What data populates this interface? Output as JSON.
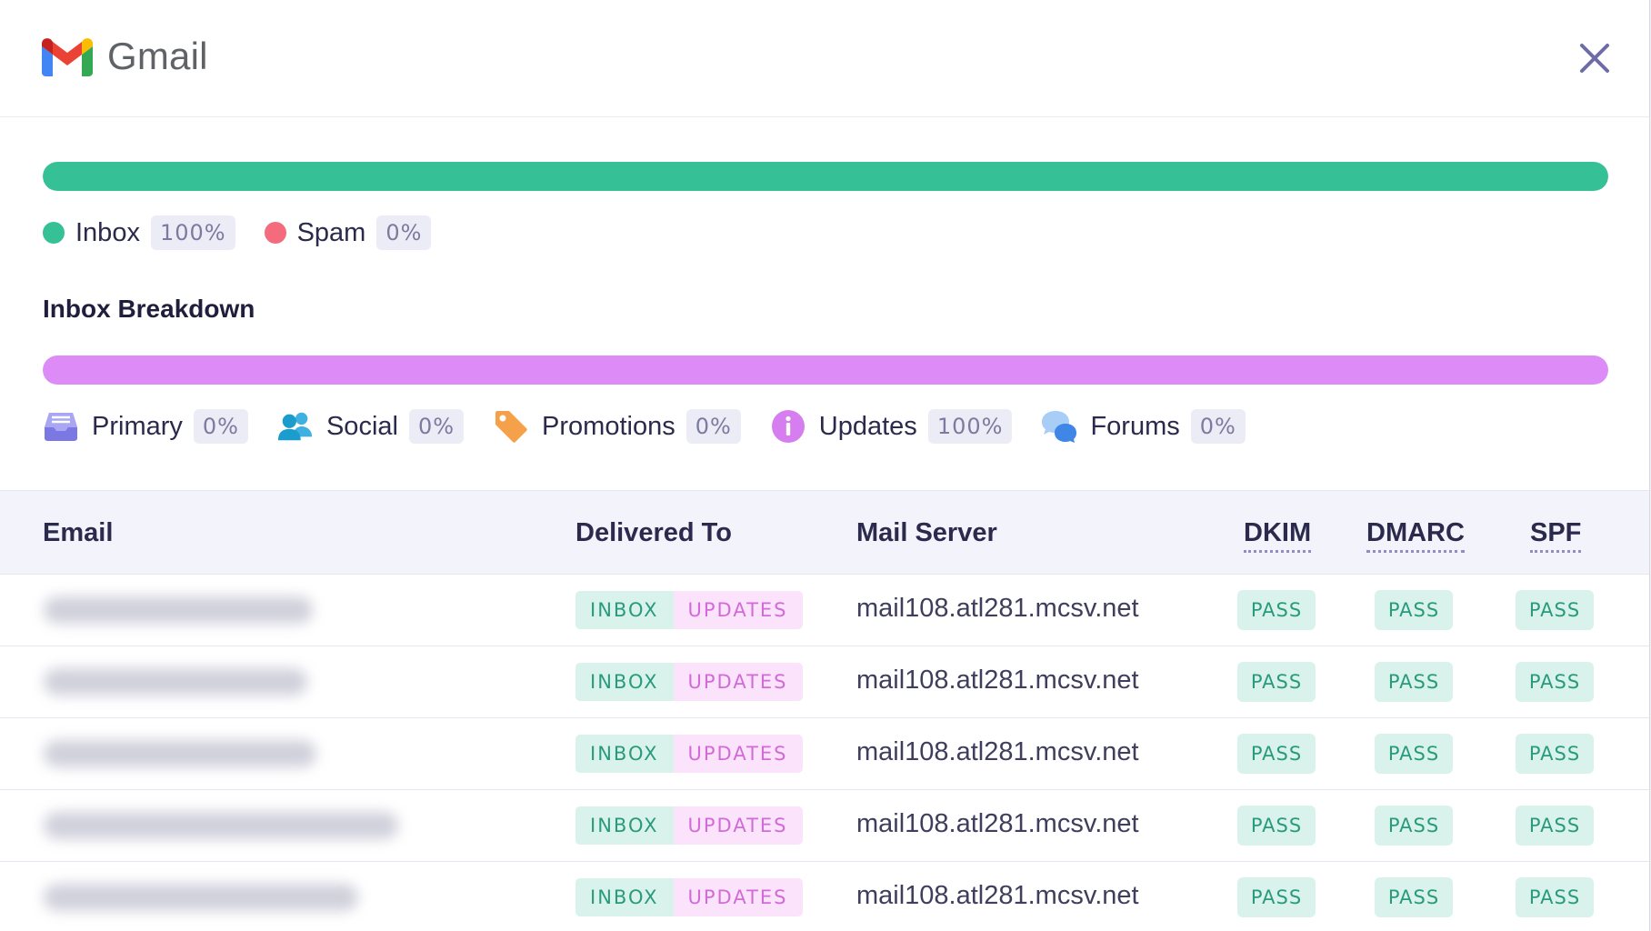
{
  "header": {
    "brand": "Gmail",
    "logo_icon": "gmail-logo-icon",
    "close_icon": "close-icon"
  },
  "placement": {
    "bar_fill_fraction": 1.0,
    "bar_color": "#35c095",
    "items": [
      {
        "label": "Inbox",
        "percent": "100%",
        "color": "#35c095"
      },
      {
        "label": "Spam",
        "percent": "0%",
        "color": "#f46b7d"
      }
    ]
  },
  "breakdown": {
    "title": "Inbox Breakdown",
    "bar_fill_fraction": 1.0,
    "bar_color": "#dd8bf7",
    "items": [
      {
        "label": "Primary",
        "percent": "0%",
        "icon": "inbox-tray-icon"
      },
      {
        "label": "Social",
        "percent": "0%",
        "icon": "people-icon"
      },
      {
        "label": "Promotions",
        "percent": "0%",
        "icon": "tag-icon"
      },
      {
        "label": "Updates",
        "percent": "100%",
        "icon": "info-icon"
      },
      {
        "label": "Forums",
        "percent": "0%",
        "icon": "chat-bubbles-icon"
      }
    ]
  },
  "table": {
    "columns": {
      "email": "Email",
      "delivered_to": "Delivered To",
      "mail_server": "Mail Server",
      "dkim": "DKIM",
      "dmarc": "DMARC",
      "spf": "SPF"
    },
    "rows": [
      {
        "delivered_folder": "INBOX",
        "delivered_tab": "UPDATES",
        "mail_server": "mail108.atl281.mcsv.net",
        "dkim": "PASS",
        "dmarc": "PASS",
        "spf": "PASS"
      },
      {
        "delivered_folder": "INBOX",
        "delivered_tab": "UPDATES",
        "mail_server": "mail108.atl281.mcsv.net",
        "dkim": "PASS",
        "dmarc": "PASS",
        "spf": "PASS"
      },
      {
        "delivered_folder": "INBOX",
        "delivered_tab": "UPDATES",
        "mail_server": "mail108.atl281.mcsv.net",
        "dkim": "PASS",
        "dmarc": "PASS",
        "spf": "PASS"
      },
      {
        "delivered_folder": "INBOX",
        "delivered_tab": "UPDATES",
        "mail_server": "mail108.atl281.mcsv.net",
        "dkim": "PASS",
        "dmarc": "PASS",
        "spf": "PASS"
      },
      {
        "delivered_folder": "INBOX",
        "delivered_tab": "UPDATES",
        "mail_server": "mail108.atl281.mcsv.net",
        "dkim": "PASS",
        "dmarc": "PASS",
        "spf": "PASS"
      }
    ]
  }
}
